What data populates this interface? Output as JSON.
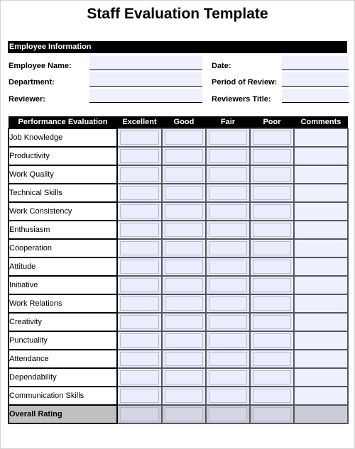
{
  "document": {
    "title": "Staff Evaluation Template",
    "section_header": "Employee Information"
  },
  "info": {
    "left": [
      {
        "label": "Employee Name:",
        "value": ""
      },
      {
        "label": "Department:",
        "value": ""
      },
      {
        "label": "Reviewer:",
        "value": ""
      }
    ],
    "right": [
      {
        "label": "Date:",
        "value": ""
      },
      {
        "label": "Period of Review:",
        "value": ""
      },
      {
        "label": "Reviewers Title:",
        "value": ""
      }
    ]
  },
  "evaluation": {
    "columns": [
      "Performance Evaluation",
      "Excellent",
      "Good",
      "Fair",
      "Poor",
      "Comments"
    ],
    "criteria": [
      "Job Knowledge",
      "Productivity",
      "Work Quality",
      "Technical Skills",
      "Work Consistency",
      "Enthusiasm",
      "Cooperation",
      "Attitude",
      "Initiative",
      "Work Relations",
      "Creativity",
      "Punctuality",
      "Attendance",
      "Dependability",
      "Communication Skills"
    ],
    "overall_label": "Overall Rating"
  }
}
